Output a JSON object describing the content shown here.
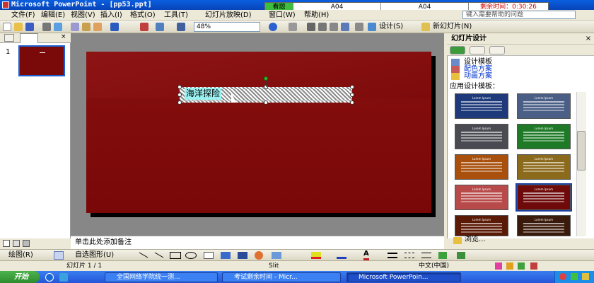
{
  "window": {
    "title": "Microsoft PowerPoint - [pp53.ppt]"
  },
  "exam_bar": {
    "view_button": "看题",
    "code1": "A04",
    "code2": "A04",
    "time_label": "剩余时间：0:30:26"
  },
  "menu": {
    "items": [
      "文件(F)",
      "编辑(E)",
      "视图(V)",
      "插入(I)",
      "格式(O)",
      "工具(T)",
      "幻灯片放映(D)",
      "窗口(W)",
      "帮助(H)"
    ],
    "help_placeholder": "键入需要帮助的问题"
  },
  "toolbar": {
    "zoom": "48%",
    "design_label": "设计(S)",
    "new_slide_label": "新幻灯片(N)"
  },
  "thumbnails": {
    "slide_number": "1"
  },
  "slide": {
    "text": "海洋探险"
  },
  "notes": {
    "placeholder": "单击此处添加备注"
  },
  "task_pane": {
    "title": "幻灯片设计",
    "close": "×",
    "links": [
      "设计模板",
      "配色方案",
      "动画方案"
    ],
    "apply_label": "应用设计模板：",
    "browse_label": "浏览...",
    "template_title": "Lorem Ipsum",
    "templates": [
      {
        "bg": "#1F3A7A"
      },
      {
        "bg": "#4A5E86"
      },
      {
        "bg": "#4A4A52"
      },
      {
        "bg": "#1E7A26"
      },
      {
        "bg": "#A8500C"
      },
      {
        "bg": "#8C6A1C"
      },
      {
        "bg": "#B84A4A"
      },
      {
        "bg": "#6E0A0A"
      },
      {
        "bg": "#5A1A06"
      },
      {
        "bg": "#3A1A0A"
      }
    ]
  },
  "drawing_toolbar": {
    "draw_label": "绘图(R)",
    "autoshape_label": "自选图形(U)"
  },
  "status": {
    "slide_info": "幻灯片 1 / 1",
    "design": "Slit",
    "language": "中文(中国)"
  },
  "taskbar": {
    "start": "开始",
    "tasks": [
      "全国网络学院统一测...",
      "考试剩余时间 - Micr...",
      "Microsoft PowerPoin..."
    ]
  }
}
